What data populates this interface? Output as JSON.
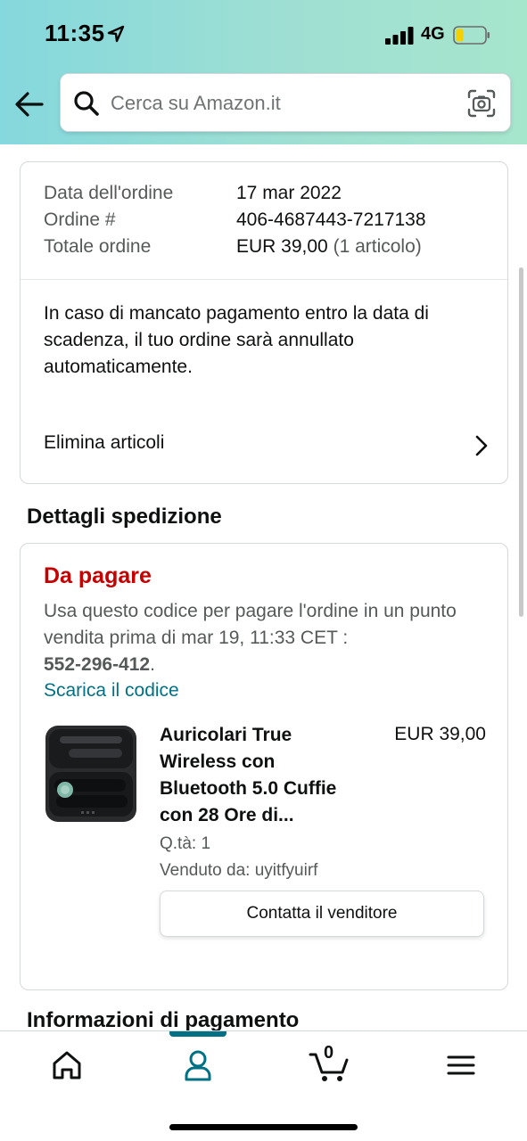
{
  "status_bar": {
    "time": "11:35",
    "network": "4G"
  },
  "search": {
    "placeholder": "Cerca su Amazon.it"
  },
  "order_summary": {
    "rows": [
      {
        "label": "Data dell'ordine",
        "value": "17 mar 2022"
      },
      {
        "label": "Ordine #",
        "value": "406-4687443-7217138"
      },
      {
        "label": "Totale ordine",
        "value": "EUR 39,00",
        "value_note": "(1 articolo)"
      }
    ],
    "notice": "In caso di mancato pagamento entro la data di scadenza, il tuo ordine sarà annullato automaticamente.",
    "delete_label": "Elimina articoli"
  },
  "shipping": {
    "title": "Dettagli spedizione",
    "status": "Da pagare",
    "instructions": "Usa questo codice per pagare l'ordine in un punto vendita prima di mar 19, 11:33 CET :",
    "code": "552-296-412",
    "code_suffix": ".",
    "download_link": "Scarica il codice",
    "product": {
      "title": "Auricolari True Wireless con Bluetooth 5.0 Cuffie con 28 Ore di...",
      "price": "EUR 39,00",
      "quantity": "Q.tà: 1",
      "seller": "Venduto da: uyitfyuirf",
      "contact_label": "Contatta il venditore"
    }
  },
  "payment_title": "Informazioni di pagamento",
  "nav": {
    "cart_count": "0",
    "active": "profile"
  },
  "colors": {
    "accent": "#007185",
    "alert": "#c40000",
    "gradient_start": "#85d8dd",
    "gradient_end": "#a6e6cd"
  }
}
